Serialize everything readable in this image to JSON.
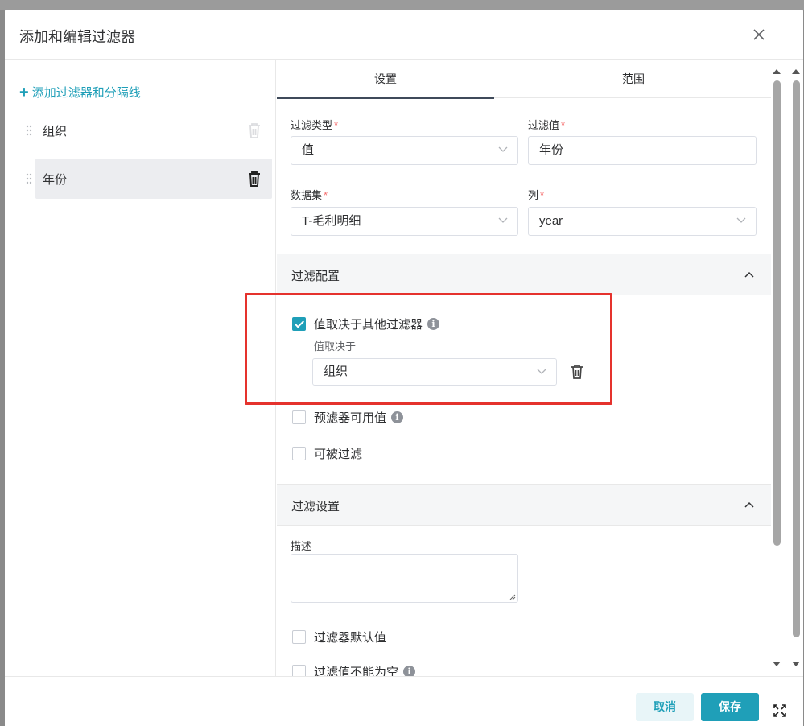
{
  "dialog": {
    "title": "添加和编辑过滤器"
  },
  "left": {
    "add_label": "添加过滤器和分隔线",
    "items": [
      {
        "name": "组织"
      },
      {
        "name": "年份"
      }
    ]
  },
  "tabs": [
    {
      "label": "设置"
    },
    {
      "label": "范围"
    }
  ],
  "form": {
    "filter_type_label": "过滤类型",
    "filter_type_value": "值",
    "filter_value_label": "过滤值",
    "filter_value_value": "年份",
    "dataset_label": "数据集",
    "dataset_value": "T-毛利明细",
    "column_label": "列",
    "column_value": "year"
  },
  "filter_config": {
    "title": "过滤配置",
    "depends_label": "值取决于其他过滤器",
    "depends_checked": true,
    "depends_sub_label": "值取决于",
    "depends_value": "组织",
    "prefilter_label": "预滤器可用值",
    "filterable_label": "可被过滤"
  },
  "filter_settings": {
    "title": "过滤设置",
    "description_label": "描述",
    "default_value_label": "过滤器默认值",
    "required_label": "过滤值不能为空"
  },
  "footer": {
    "cancel_label": "取消",
    "save_label": "保存"
  },
  "colors": {
    "accent": "#1f9fb8",
    "highlight": "#e5322d",
    "required": "#f56c6c"
  }
}
